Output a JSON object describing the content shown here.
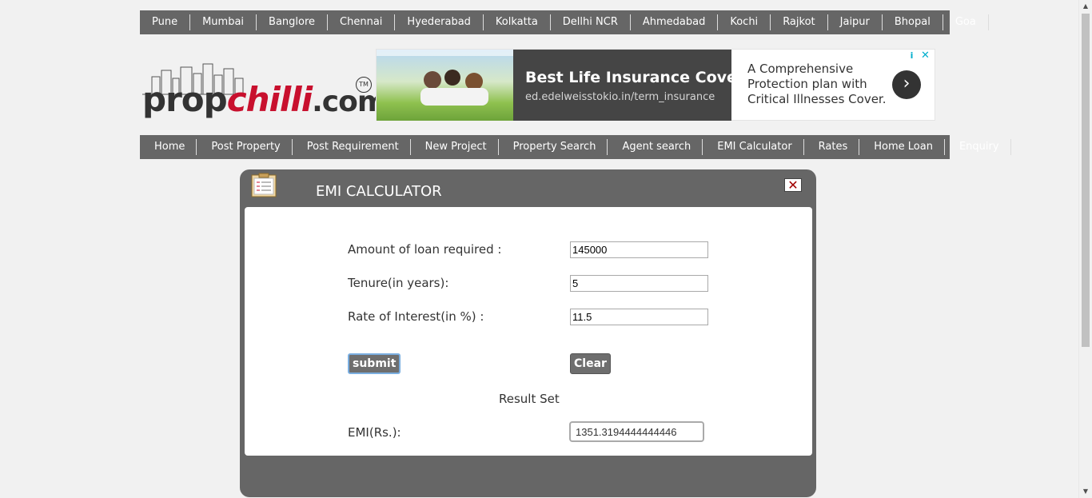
{
  "city_nav": [
    "Pune",
    "Mumbai",
    "Banglore",
    "Chennai",
    "Hyederabad",
    "Kolkatta",
    "Dellhi NCR",
    "Ahmedabad",
    "Kochi",
    "Rajkot",
    "Jaipur",
    "Bhopal",
    "Goa"
  ],
  "logo": {
    "prop": "prop",
    "chilli": "chilli",
    "dotcom": ".com",
    "tm": "TM"
  },
  "ad": {
    "headline": "Best Life Insurance Cover",
    "url": "ed.edelweisstokio.in/term_insurance",
    "text": "A Comprehensive Protection plan with Critical Illnesses Cover.",
    "arrow": "›",
    "info": "i",
    "close": "✕"
  },
  "main_nav": [
    "Home",
    "Post Property",
    "Post Requirement",
    "New Project",
    "Property Search",
    "Agent search",
    "EMI Calculator",
    "Rates",
    "Home Loan",
    "Enquiry"
  ],
  "modal": {
    "title": "EMI CALCULATOR",
    "close": "✕",
    "loan_label": "Amount of loan required :",
    "loan_value": "145000",
    "tenure_label": "Tenure(in years):",
    "tenure_value": "5",
    "rate_label": "Rate of Interest(in %) :",
    "rate_value": "11.5",
    "submit_label": "submit",
    "clear_label": "Clear",
    "result_heading": "Result Set",
    "emi_label": "EMI(Rs.):",
    "emi_value": "1351.3194444444446"
  },
  "colors": {
    "nav_bg": "#666666",
    "modal_bg": "#666666",
    "chilli_red": "#c8102e",
    "ad_dark": "#454545"
  }
}
